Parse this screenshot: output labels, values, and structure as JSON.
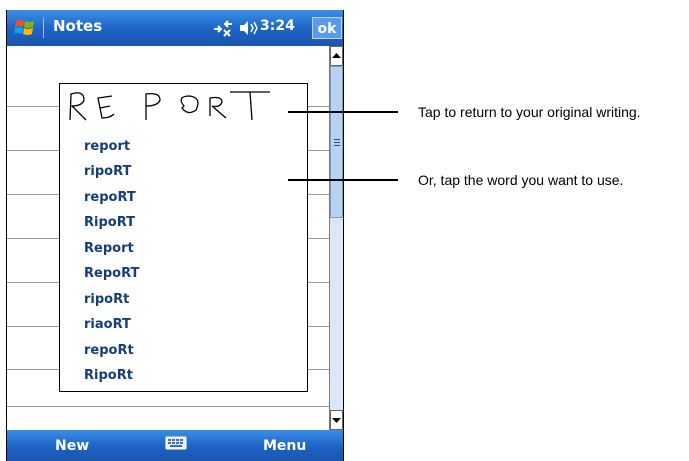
{
  "titlebar": {
    "app_title": "Notes",
    "clock": "3:24",
    "ok_label": "ok",
    "icons": [
      "windows-start-icon",
      "connectivity-icon",
      "volume-icon"
    ],
    "accent_color": "#1d63c4"
  },
  "ink_text": "REPORT",
  "suggestions": [
    "report",
    "ripoRT",
    "repoRT",
    "RipoRT",
    "Report",
    "RepoRT",
    "ripoRt",
    "riaoRT",
    "repoRt",
    "RipoRt"
  ],
  "bottombar": {
    "new_label": "New",
    "menu_label": "Menu",
    "icons": [
      "keyboard-icon"
    ]
  },
  "callouts": {
    "top": "Tap to return to your original writing.",
    "bottom": "Or, tap the word you want to use."
  }
}
